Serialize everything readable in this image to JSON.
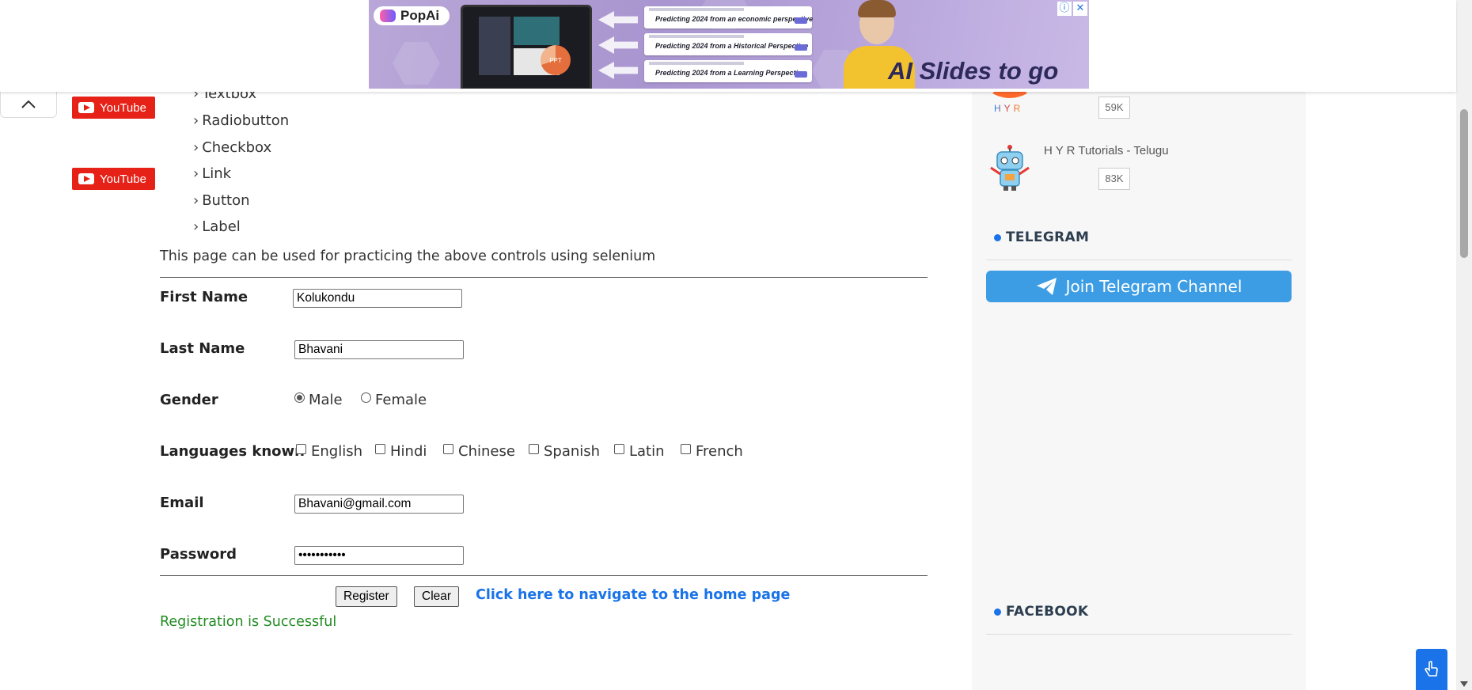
{
  "ad": {
    "brand": "PopAi",
    "laptop_badge": "PPT",
    "cards": [
      "Predicting 2024 from an economic perspective",
      "Predicting 2024 from a Historical Perspective",
      "Predicting 2024 from a Learning Perspective"
    ],
    "slogan": "AI Slides to go",
    "info_icon": "ⓘ",
    "close_icon": "✕"
  },
  "menu": {
    "items": [
      "Textbox",
      "Radiobutton",
      "Checkbox",
      "Link",
      "Button",
      "Label"
    ],
    "chevron": "›"
  },
  "intro_text": "This page can be used for practicing the above controls using selenium",
  "form": {
    "first_name_label": "First Name",
    "first_name_value": "Kolukondu",
    "last_name_label": "Last Name",
    "last_name_value": "Bhavani",
    "gender_label": "Gender",
    "gender_options": [
      "Male",
      "Female"
    ],
    "gender_selected": "Male",
    "languages_label": "Languages known",
    "languages": [
      "English",
      "Hindi",
      "Chinese",
      "Spanish",
      "Latin",
      "French"
    ],
    "email_label": "Email",
    "email_value": "Bhavani@gmail.com",
    "password_label": "Password",
    "password_value": "•••••••••••",
    "register_label": "Register",
    "clear_label": "Clear",
    "home_link": "Click here to navigate to the home page",
    "success_message": "Registration is Successful"
  },
  "sidebar": {
    "channel1": {
      "logo_text": "HYR",
      "button": "YouTube",
      "count": "59K"
    },
    "channel2": {
      "name": "H Y R Tutorials - Telugu",
      "button": "YouTube",
      "count": "83K"
    },
    "telegram_title": "TELEGRAM",
    "telegram_button": "Join Telegram Channel",
    "facebook_title": "FACEBOOK"
  },
  "colors": {
    "link": "#1a73e8",
    "success": "#228b22",
    "youtube": "#e62117",
    "telegram": "#3d9de4"
  }
}
